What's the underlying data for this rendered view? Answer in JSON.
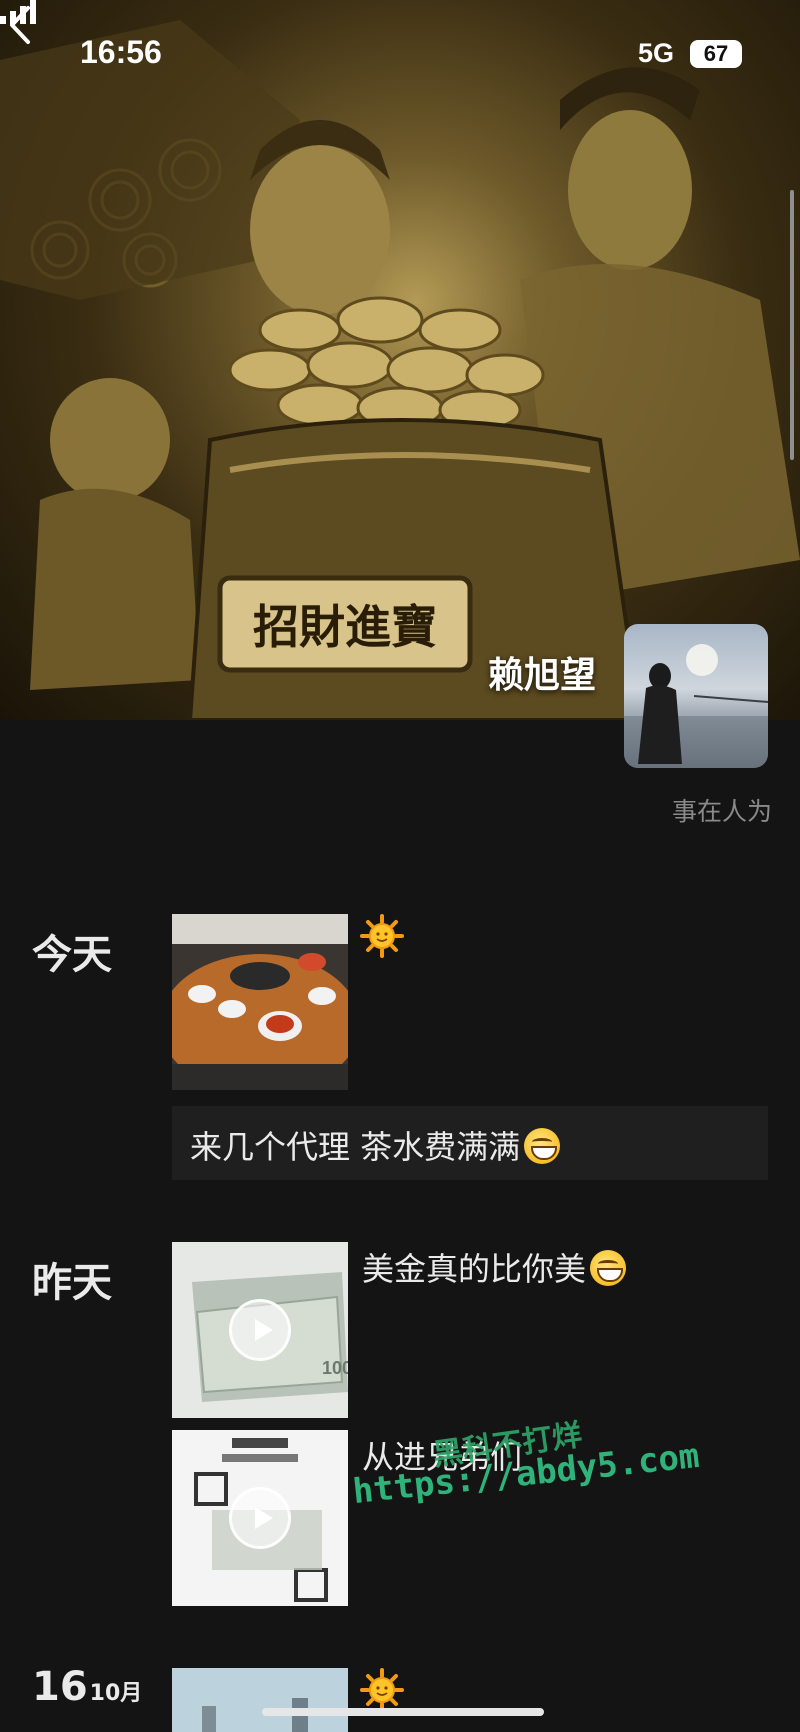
{
  "status_bar": {
    "time": "16:56",
    "network": "5G",
    "battery": "67"
  },
  "profile": {
    "name": "赖旭望",
    "signature": "事在人为",
    "cover_plaque_text": "招財進寶"
  },
  "feed": [
    {
      "day": "今天",
      "posts": [
        {
          "type": "image",
          "icon": "sun-emoji"
        },
        {
          "type": "text",
          "text": "来几个代理 茶水费满满",
          "emoji": "grinning-emoji"
        }
      ]
    },
    {
      "day": "昨天",
      "posts": [
        {
          "type": "video",
          "text": "美金真的比你美",
          "emoji": "grinning-emoji"
        },
        {
          "type": "video",
          "text": "从进兄弟们"
        }
      ]
    },
    {
      "day_num": "16",
      "month": "10月",
      "posts": [
        {
          "type": "image",
          "icon": "sun-emoji"
        }
      ]
    }
  ],
  "watermark": {
    "text": "黑科不打烊",
    "url": "https://abdy5.com"
  },
  "colors": {
    "background": "#141414",
    "text_box": "#1f1f1f",
    "watermark": "#2fb37a"
  }
}
